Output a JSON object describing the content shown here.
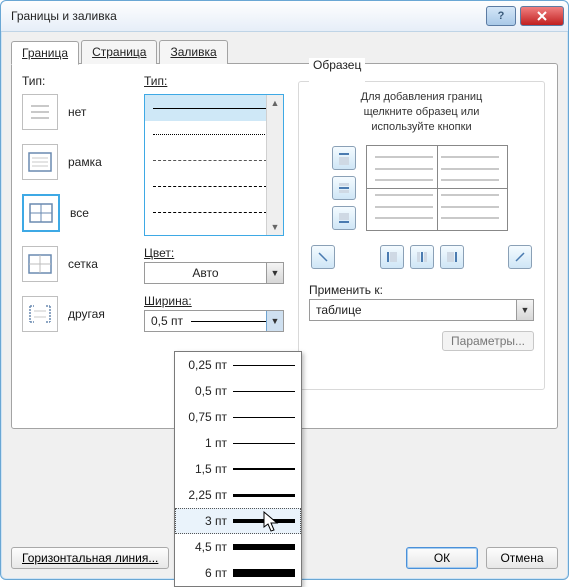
{
  "window": {
    "title": "Границы и заливка"
  },
  "tabs": {
    "border": "Граница",
    "page": "Страница",
    "fill": "Заливка"
  },
  "left": {
    "group_label": "Тип:",
    "items": [
      {
        "label": "нет"
      },
      {
        "label": "рамка"
      },
      {
        "label": "все"
      },
      {
        "label": "сетка"
      },
      {
        "label": "другая"
      }
    ],
    "selected_index": 2
  },
  "mid": {
    "style_label": "Тип:",
    "color_label": "Цвет:",
    "color_value": "Авто",
    "width_label": "Ширина:",
    "width_value": "0,5 пт",
    "width_options": [
      "0,25 пт",
      "0,5 пт",
      "0,75 пт",
      "1 пт",
      "1,5 пт",
      "2,25 пт",
      "3 пт",
      "4,5 пт",
      "6 пт"
    ],
    "width_highlight_index": 6
  },
  "right": {
    "group_label": "Образец",
    "hint_line1": "Для добавления границ",
    "hint_line2": "щелкните образец или",
    "hint_line3": "используйте кнопки",
    "apply_label": "Применить к:",
    "apply_value": "таблице",
    "params_btn": "Параметры..."
  },
  "footer": {
    "hline": "Горизонтальная линия...",
    "ok": "ОК",
    "cancel": "Отмена"
  }
}
